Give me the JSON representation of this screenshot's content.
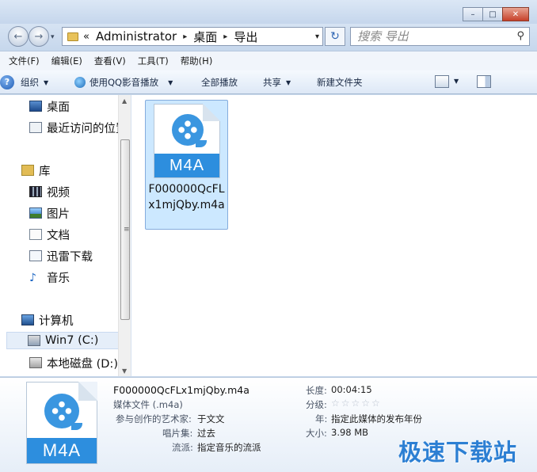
{
  "window": {
    "minimize_glyph": "–",
    "maximize_glyph": "□",
    "close_glyph": "✕"
  },
  "nav": {
    "back_glyph": "←",
    "forward_glyph": "→",
    "history_glyph": "▾",
    "breadcrumb_chevron": "«",
    "breadcrumb": [
      "Administrator",
      "桌面",
      "导出"
    ],
    "breadcrumb_sep": "▸",
    "address_dropdown": "▾",
    "refresh_glyph": "↻",
    "search_placeholder": "搜索 导出",
    "search_glyph": "⚲"
  },
  "menu": [
    "文件(F)",
    "编辑(E)",
    "查看(V)",
    "工具(T)",
    "帮助(H)"
  ],
  "toolbar": {
    "organize": "组织",
    "play_with_qq": "使用QQ影音播放",
    "play_all": "全部播放",
    "share": "共享",
    "new_folder": "新建文件夹",
    "dropdown_glyph": "▼",
    "help_glyph": "?"
  },
  "tree": [
    {
      "label": "桌面",
      "icon": "desktop-icon"
    },
    {
      "label": "最近访问的位置",
      "icon": "recent-places-icon"
    },
    {
      "label": "库",
      "icon": "library-icon"
    },
    {
      "label": "视频",
      "icon": "video-icon"
    },
    {
      "label": "图片",
      "icon": "picture-icon"
    },
    {
      "label": "文档",
      "icon": "document-icon"
    },
    {
      "label": "迅雷下载",
      "icon": "xunlei-icon"
    },
    {
      "label": "音乐",
      "icon": "music-icon"
    },
    {
      "label": "计算机",
      "icon": "computer-icon"
    },
    {
      "label": "Win7 (C:)",
      "icon": "drive-c-icon"
    },
    {
      "label": "本地磁盘 (D:)",
      "icon": "local-disk-icon"
    }
  ],
  "scroll": {
    "up": "▲",
    "down": "▼",
    "grip": "≡"
  },
  "file": {
    "badge": "M4A",
    "name": "F000000QcFLx1mjQby.m4a"
  },
  "details": {
    "badge": "M4A",
    "title": "F000000QcFLx1mjQby.m4a",
    "type": "媒体文件 (.m4a)",
    "artist_label": "参与创作的艺术家:",
    "artist": "于文文",
    "album_label": "唱片集:",
    "album": "过去",
    "genre_label": "流派:",
    "genre": "指定音乐的流派",
    "length_label": "长度:",
    "length": "00:04:15",
    "rating_label": "分级:",
    "rating_stars": "☆☆☆☆☆",
    "year_label": "年:",
    "year": "指定此媒体的发布年份",
    "size_label": "大小:",
    "size": "3.98 MB"
  },
  "watermark": "极速下载站"
}
